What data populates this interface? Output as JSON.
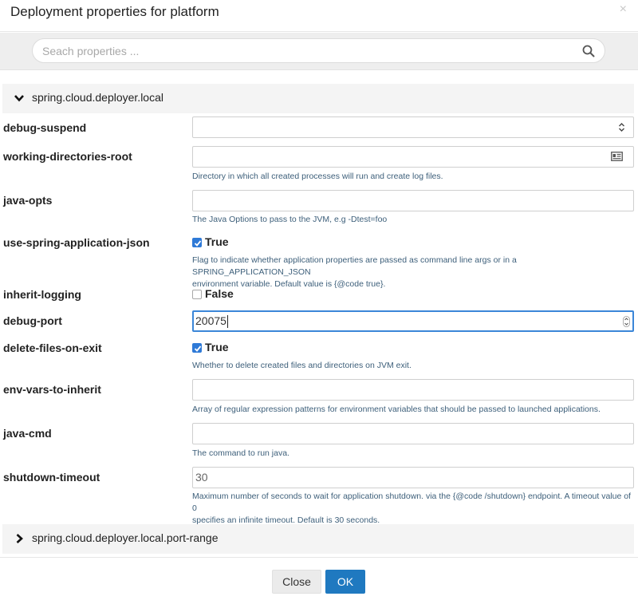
{
  "dialog": {
    "title": "Deployment properties for platform",
    "close_glyph": "×"
  },
  "search": {
    "placeholder": "Seach properties ..."
  },
  "groups": [
    {
      "title": "spring.cloud.deployer.local",
      "expanded": true,
      "icon": "chevron-down-icon"
    },
    {
      "title": "spring.cloud.deployer.local.port-range",
      "expanded": false,
      "icon": "chevron-right-icon"
    }
  ],
  "properties": {
    "debug_suspend": {
      "label": "debug-suspend",
      "value": ""
    },
    "working_directories_root": {
      "label": "working-directories-root",
      "value": "",
      "help": "Directory in which all created processes will run and create log files."
    },
    "java_opts": {
      "label": "java-opts",
      "value": "",
      "help": "The Java Options to pass to the JVM, e.g -Dtest=foo"
    },
    "use_spring_application_json": {
      "label": "use-spring-application-json",
      "checked": true,
      "state_label": "True",
      "help_line1": "Flag to indicate whether application properties are passed as command line args or in a SPRING_APPLICATION_JSON",
      "help_line2": "environment variable. Default value is {@code true}."
    },
    "inherit_logging": {
      "label": "inherit-logging",
      "checked": false,
      "state_label": "False"
    },
    "debug_port": {
      "label": "debug-port",
      "value": "20075"
    },
    "delete_files_on_exit": {
      "label": "delete-files-on-exit",
      "checked": true,
      "state_label": "True",
      "help": "Whether to delete created files and directories on JVM exit."
    },
    "env_vars_to_inherit": {
      "label": "env-vars-to-inherit",
      "value": "",
      "help": "Array of regular expression patterns for environment variables that should be passed to launched applications."
    },
    "java_cmd": {
      "label": "java-cmd",
      "value": "",
      "help": "The command to run java."
    },
    "shutdown_timeout": {
      "label": "shutdown-timeout",
      "value": "30",
      "help_line1": "Maximum number of seconds to wait for application shutdown. via the {@code /shutdown} endpoint. A timeout value of 0",
      "help_line2": "specifies an infinite timeout. Default is 30 seconds."
    }
  },
  "footer": {
    "close_label": "Close",
    "ok_label": "OK"
  },
  "colors": {
    "primary": "#1f79c0",
    "focus": "#3b86d8",
    "help_text": "#3d5f7a",
    "checkbox": "#2f7ad7"
  }
}
